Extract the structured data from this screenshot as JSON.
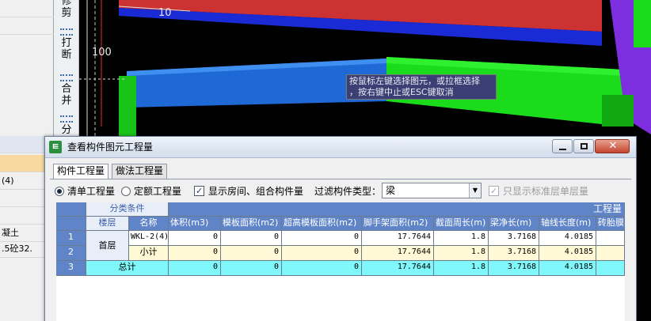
{
  "left_panel": {
    "rows": [
      {
        "label": ""
      },
      {
        "label": ""
      },
      {
        "label": ""
      },
      {
        "label": "(4)"
      },
      {
        "label": ""
      },
      {
        "label": ""
      },
      {
        "label": ""
      },
      {
        "label": "凝土"
      },
      {
        "label": ".5砼32."
      }
    ],
    "pin_glyph": "ᵖ"
  },
  "toolbar": {
    "items": [
      {
        "label": "修\n剪",
        "icon": "trim-icon"
      },
      {
        "label": "打\n断",
        "icon": "break-icon"
      },
      {
        "label": "合\n并",
        "icon": "merge-icon"
      },
      {
        "label": "分",
        "icon": "split-icon"
      }
    ]
  },
  "viewport": {
    "dims": [
      "10",
      "100"
    ],
    "tooltip_lines": [
      "按鼠标左键选择图元，或拉框选择",
      "，按右键中止或ESC键取消"
    ]
  },
  "dialog": {
    "icon_glyph": "ㅌ",
    "title": "查看构件图元工程量",
    "tabs": [
      "构件工程量",
      "做法工程量"
    ],
    "options": {
      "radio_list": "清单工程量",
      "radio_quota": "定额工程量",
      "show_room": "显示房间、组合构件量",
      "filter_label": "过滤构件类型：",
      "filter_value": "梁",
      "filter_arrow": "▼",
      "only_std": "只显示标准层单层量"
    },
    "table": {
      "group_header": "分类条件",
      "quantity_header": "工程量",
      "col_headers": [
        "楼层",
        "名称",
        "体积(m3)",
        "模板面积(m2)",
        "超高模板面积(m2)",
        "脚手架面积(m2)",
        "截面周长(m)",
        "梁净长(m)",
        "轴线长度(m)",
        "砖胎膜"
      ],
      "rows": [
        {
          "num": "1",
          "floor": "首层",
          "name": "WKL-2(4)",
          "values": [
            "0",
            "0",
            "0",
            "17.7644",
            "1.8",
            "3.7168",
            "4.0185"
          ]
        },
        {
          "num": "2",
          "floor": "",
          "name": "小计",
          "values": [
            "0",
            "0",
            "0",
            "17.7644",
            "1.8",
            "3.7168",
            "4.0185"
          ]
        },
        {
          "num": "3",
          "floor": "",
          "name": "总计",
          "values": [
            "0",
            "0",
            "0",
            "17.7644",
            "1.8",
            "3.7168",
            "4.0185"
          ]
        }
      ]
    }
  }
}
